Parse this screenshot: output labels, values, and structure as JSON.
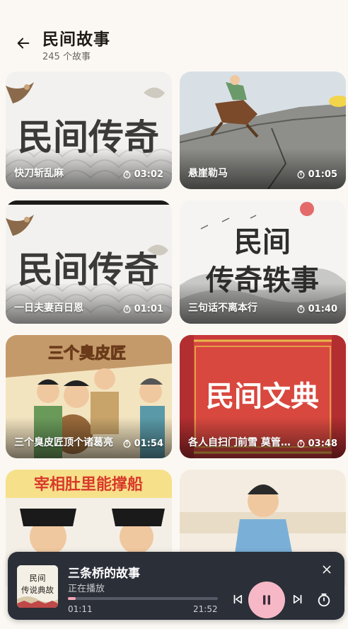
{
  "header": {
    "title": "民间故事",
    "subtitle": "245 个故事"
  },
  "colors": {
    "background": "#fbf8f3",
    "player_bg": "#2b2f38",
    "accent": "#f6b8c6"
  },
  "stories": [
    {
      "title": "快刀斩乱麻",
      "duration": "03:02",
      "thumb_text": "民间传奇"
    },
    {
      "title": "悬崖勒马",
      "duration": "01:05",
      "thumb_text": ""
    },
    {
      "title": "一日夫妻百日恩",
      "duration": "01:01",
      "thumb_text": "民间传奇"
    },
    {
      "title": "三句话不离本行",
      "duration": "01:40",
      "thumb_text_1": "民间",
      "thumb_text_2": "传奇轶事"
    },
    {
      "title": "三个臭皮匠顶个诸葛亮",
      "duration": "01:54",
      "thumb_text": "三个臭皮匠"
    },
    {
      "title": "各人自扫门前雪 莫管他人瓦上霜",
      "duration": "03:48",
      "thumb_text": "民间文典"
    },
    {
      "title": "",
      "duration": "",
      "thumb_text": "宰相肚里能撑船"
    },
    {
      "title": "",
      "duration": "",
      "thumb_text": ""
    }
  ],
  "player": {
    "art_text": "民间\n传说典故",
    "title": "三条桥的故事",
    "status": "正在播放",
    "current_time": "01:11",
    "total_time": "21:52",
    "progress": 0.054
  },
  "icons": {
    "back": "arrow-left-icon",
    "duration": "timer-icon",
    "prev": "skip-previous-icon",
    "play_pause": "pause-icon",
    "next": "skip-next-icon",
    "sleep_timer": "stopwatch-icon",
    "close": "close-icon"
  }
}
